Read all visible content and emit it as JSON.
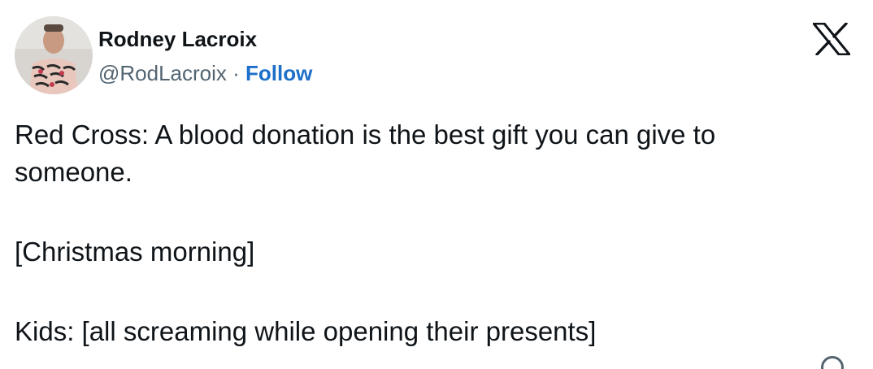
{
  "author": {
    "display_name": "Rodney Lacroix",
    "handle": "@RodLacroix",
    "separator": " · ",
    "follow_label": "Follow",
    "avatar_icon": "avatar-photo"
  },
  "platform_icon": "x-logo-icon",
  "tweet": {
    "lines": [
      "Red Cross: A blood donation is the best gift you can give to",
      "someone.",
      "[Christmas morning]",
      "Kids: [all screaming while opening their presents]"
    ]
  },
  "colors": {
    "text": "#0f1419",
    "secondary": "#536471",
    "follow": "#1d6fc9",
    "background": "#ffffff"
  }
}
